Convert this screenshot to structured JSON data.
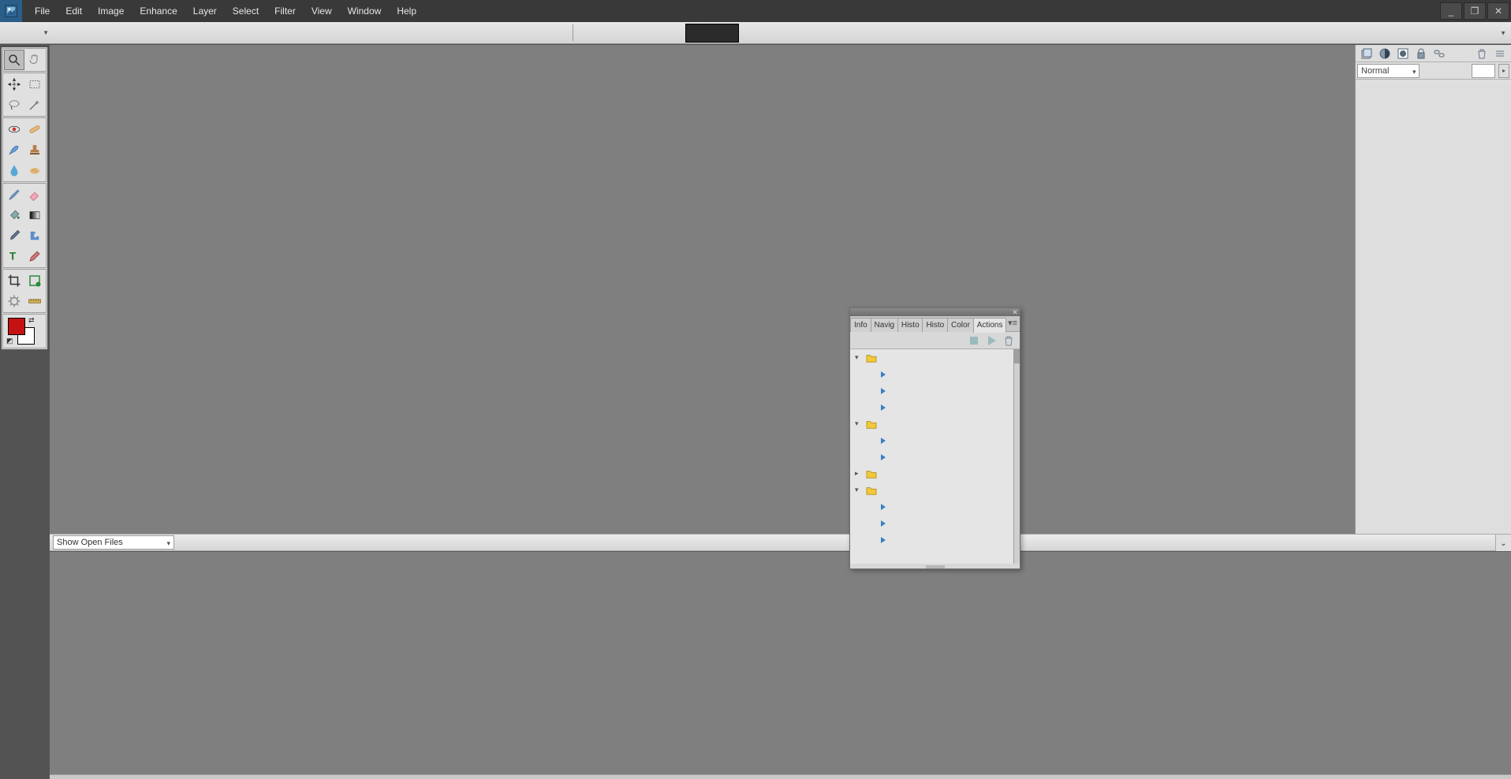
{
  "menubar": {
    "items": [
      "File",
      "Edit",
      "Image",
      "Enhance",
      "Layer",
      "Select",
      "Filter",
      "View",
      "Window",
      "Help"
    ]
  },
  "window_controls": {
    "minimize": "_",
    "maximize": "❐",
    "close": "✕"
  },
  "layers_panel": {
    "blend_mode": "Normal"
  },
  "photo_bin": {
    "dropdown": "Show Open Files"
  },
  "float_panel": {
    "tabs": [
      "Info",
      "Navig",
      "Histo",
      "Histo",
      "Color",
      "Actions"
    ],
    "active_tab": 5
  },
  "colors": {
    "foreground": "#c41111",
    "background": "#ffffff"
  }
}
